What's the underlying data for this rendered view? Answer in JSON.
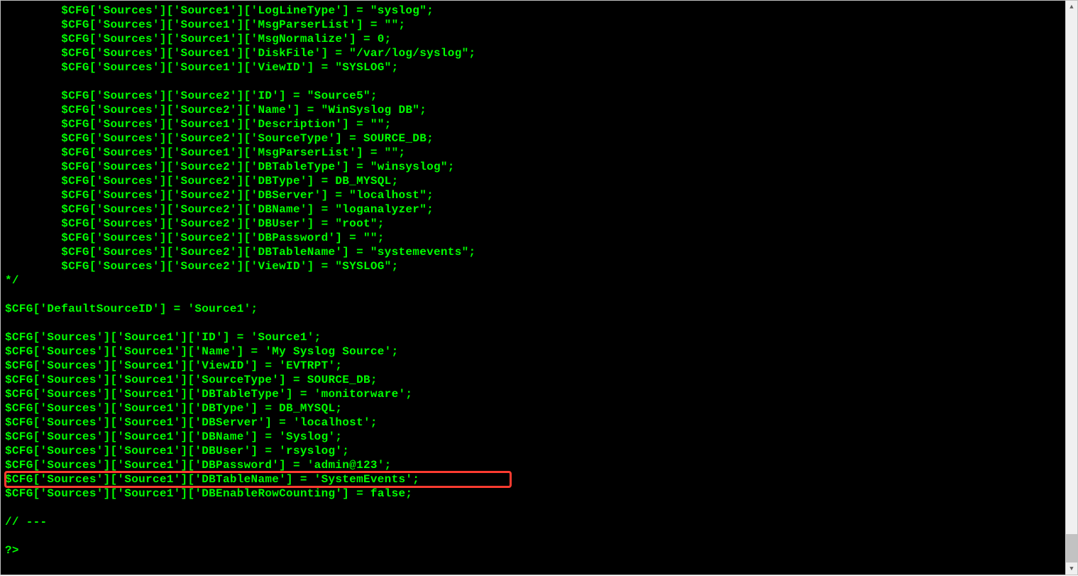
{
  "code": {
    "lines": [
      "        $CFG['Sources']['Source1']['LogLineType'] = \"syslog\";",
      "        $CFG['Sources']['Source1']['MsgParserList'] = \"\";",
      "        $CFG['Sources']['Source1']['MsgNormalize'] = 0;",
      "        $CFG['Sources']['Source1']['DiskFile'] = \"/var/log/syslog\";",
      "        $CFG['Sources']['Source1']['ViewID'] = \"SYSLOG\";",
      "",
      "        $CFG['Sources']['Source2']['ID'] = \"Source5\";",
      "        $CFG['Sources']['Source2']['Name'] = \"WinSyslog DB\";",
      "        $CFG['Sources']['Source1']['Description'] = \"\";",
      "        $CFG['Sources']['Source2']['SourceType'] = SOURCE_DB;",
      "        $CFG['Sources']['Source1']['MsgParserList'] = \"\";",
      "        $CFG['Sources']['Source2']['DBTableType'] = \"winsyslog\";",
      "        $CFG['Sources']['Source2']['DBType'] = DB_MYSQL;",
      "        $CFG['Sources']['Source2']['DBServer'] = \"localhost\";",
      "        $CFG['Sources']['Source2']['DBName'] = \"loganalyzer\";",
      "        $CFG['Sources']['Source2']['DBUser'] = \"root\";",
      "        $CFG['Sources']['Source2']['DBPassword'] = \"\";",
      "        $CFG['Sources']['Source2']['DBTableName'] = \"systemevents\";",
      "        $CFG['Sources']['Source2']['ViewID'] = \"SYSLOG\";",
      "*/",
      "",
      "$CFG['DefaultSourceID'] = 'Source1';",
      "",
      "$CFG['Sources']['Source1']['ID'] = 'Source1';",
      "$CFG['Sources']['Source1']['Name'] = 'My Syslog Source';",
      "$CFG['Sources']['Source1']['ViewID'] = 'EVTRPT';",
      "$CFG['Sources']['Source1']['SourceType'] = SOURCE_DB;",
      "$CFG['Sources']['Source1']['DBTableType'] = 'monitorware';",
      "$CFG['Sources']['Source1']['DBType'] = DB_MYSQL;",
      "$CFG['Sources']['Source1']['DBServer'] = 'localhost';",
      "$CFG['Sources']['Source1']['DBName'] = 'Syslog';",
      "$CFG['Sources']['Source1']['DBUser'] = 'rsyslog';",
      "$CFG['Sources']['Source1']['DBPassword'] = 'admin@123';",
      "$CFG['Sources']['Source1']['DBTableName'] = 'SystemEvents';",
      "$CFG['Sources']['Source1']['DBEnableRowCounting'] = false;",
      "",
      "// ---",
      "",
      "?>"
    ],
    "highlight_line_index": 33
  },
  "scrollbar": {
    "up_glyph": "▲",
    "down_glyph": "▼"
  }
}
